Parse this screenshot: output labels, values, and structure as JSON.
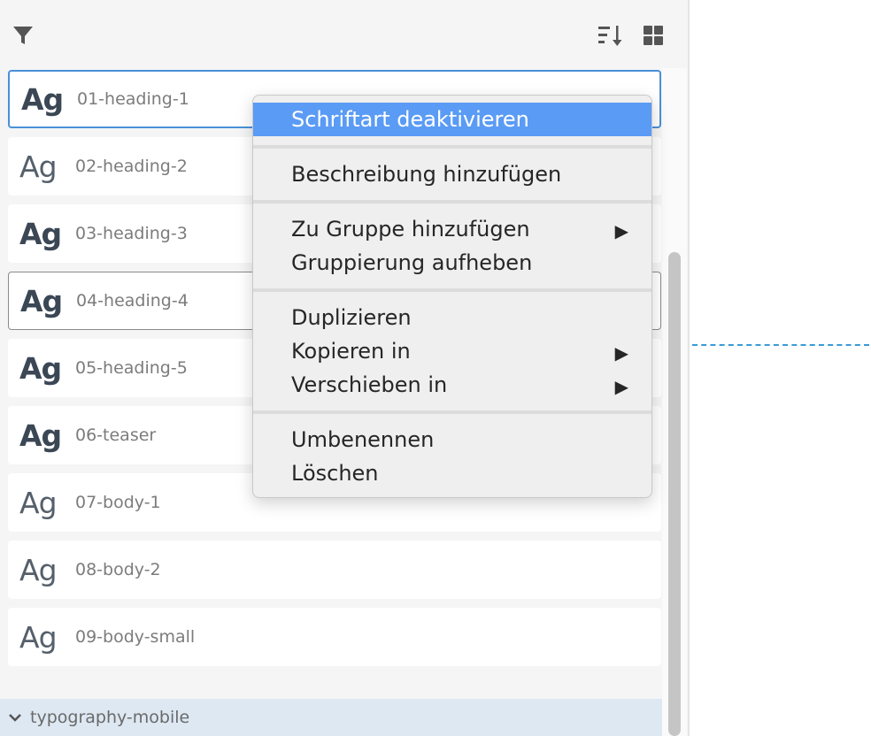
{
  "toolbar": {
    "filter_icon": "filter-icon",
    "sort_icon": "sort-icon",
    "grid_icon": "grid-view-icon"
  },
  "styles": [
    {
      "sample": "Ag",
      "name": "01-heading-1",
      "weight": "bold",
      "state": "selected"
    },
    {
      "sample": "Ag",
      "name": "02-heading-2",
      "weight": "light",
      "state": "normal"
    },
    {
      "sample": "Ag",
      "name": "03-heading-3",
      "weight": "bold",
      "state": "normal"
    },
    {
      "sample": "Ag",
      "name": "04-heading-4",
      "weight": "bold",
      "state": "hover"
    },
    {
      "sample": "Ag",
      "name": "05-heading-5",
      "weight": "bold",
      "state": "normal"
    },
    {
      "sample": "Ag",
      "name": "06-teaser",
      "weight": "bold",
      "state": "normal"
    },
    {
      "sample": "Ag",
      "name": "07-body-1",
      "weight": "light",
      "state": "normal"
    },
    {
      "sample": "Ag",
      "name": "08-body-2",
      "weight": "light",
      "state": "normal"
    },
    {
      "sample": "Ag",
      "name": "09-body-small",
      "weight": "light",
      "state": "normal"
    }
  ],
  "group": {
    "label": "typography-mobile",
    "expanded": true
  },
  "context_menu": {
    "items": [
      {
        "label": "Schriftart deaktivieren",
        "active": true,
        "submenu": false
      },
      {
        "label": "Beschreibung hinzufügen",
        "active": false,
        "submenu": false
      },
      {
        "label": "Zu Gruppe hinzufügen",
        "active": false,
        "submenu": true
      },
      {
        "label": "Gruppierung aufheben",
        "active": false,
        "submenu": false
      },
      {
        "label": "Duplizieren",
        "active": false,
        "submenu": false
      },
      {
        "label": "Kopieren in",
        "active": false,
        "submenu": true
      },
      {
        "label": "Verschieben in",
        "active": false,
        "submenu": true
      },
      {
        "label": "Umbenennen",
        "active": false,
        "submenu": false
      },
      {
        "label": "Löschen",
        "active": false,
        "submenu": false
      }
    ],
    "submenu_arrow": "▶"
  },
  "colors": {
    "selection_border": "#4a90d9",
    "menu_highlight": "#5a9bf5",
    "guide_line": "#3a9bd5",
    "group_header_bg": "#dde8f2"
  }
}
